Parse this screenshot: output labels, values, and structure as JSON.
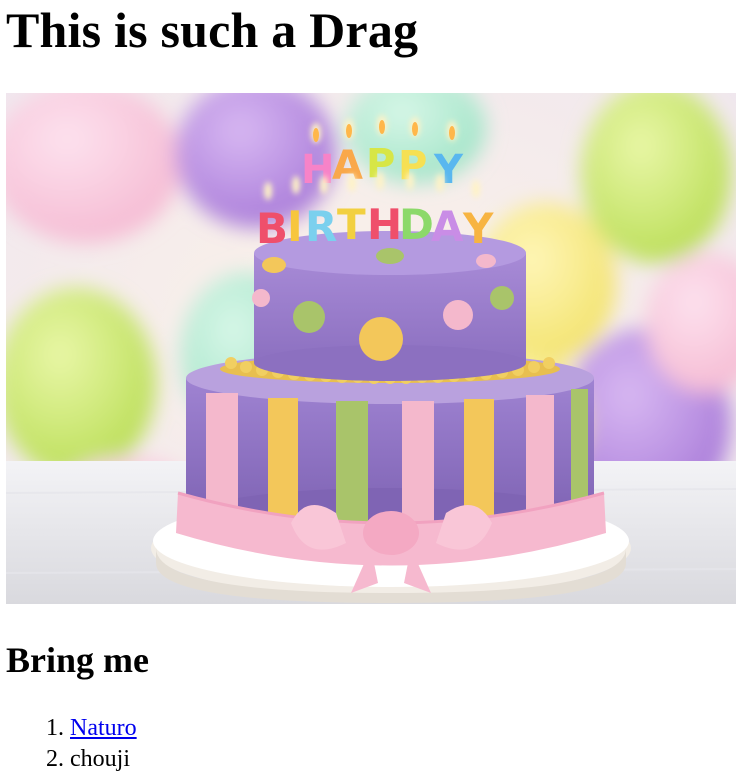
{
  "page": {
    "title": "This is such a Drag",
    "subheading": "Bring me",
    "image_alt": "Birthday cake with HAPPY BIRTHDAY candles",
    "candles": {
      "line1": [
        "H",
        "A",
        "P",
        "P",
        "Y"
      ],
      "line2": [
        "B",
        "I",
        "R",
        "T",
        "H",
        "D",
        "A",
        "Y"
      ]
    },
    "list": [
      {
        "label": "Naturo",
        "is_link": true
      },
      {
        "label": "chouji",
        "is_link": false
      }
    ]
  },
  "colors": {
    "link": "#0000ee",
    "cake_purple": "#9a7cc9",
    "cake_pink": "#f4b8cc",
    "cake_yellow": "#f3c75a",
    "cake_green": "#a9c46a"
  }
}
